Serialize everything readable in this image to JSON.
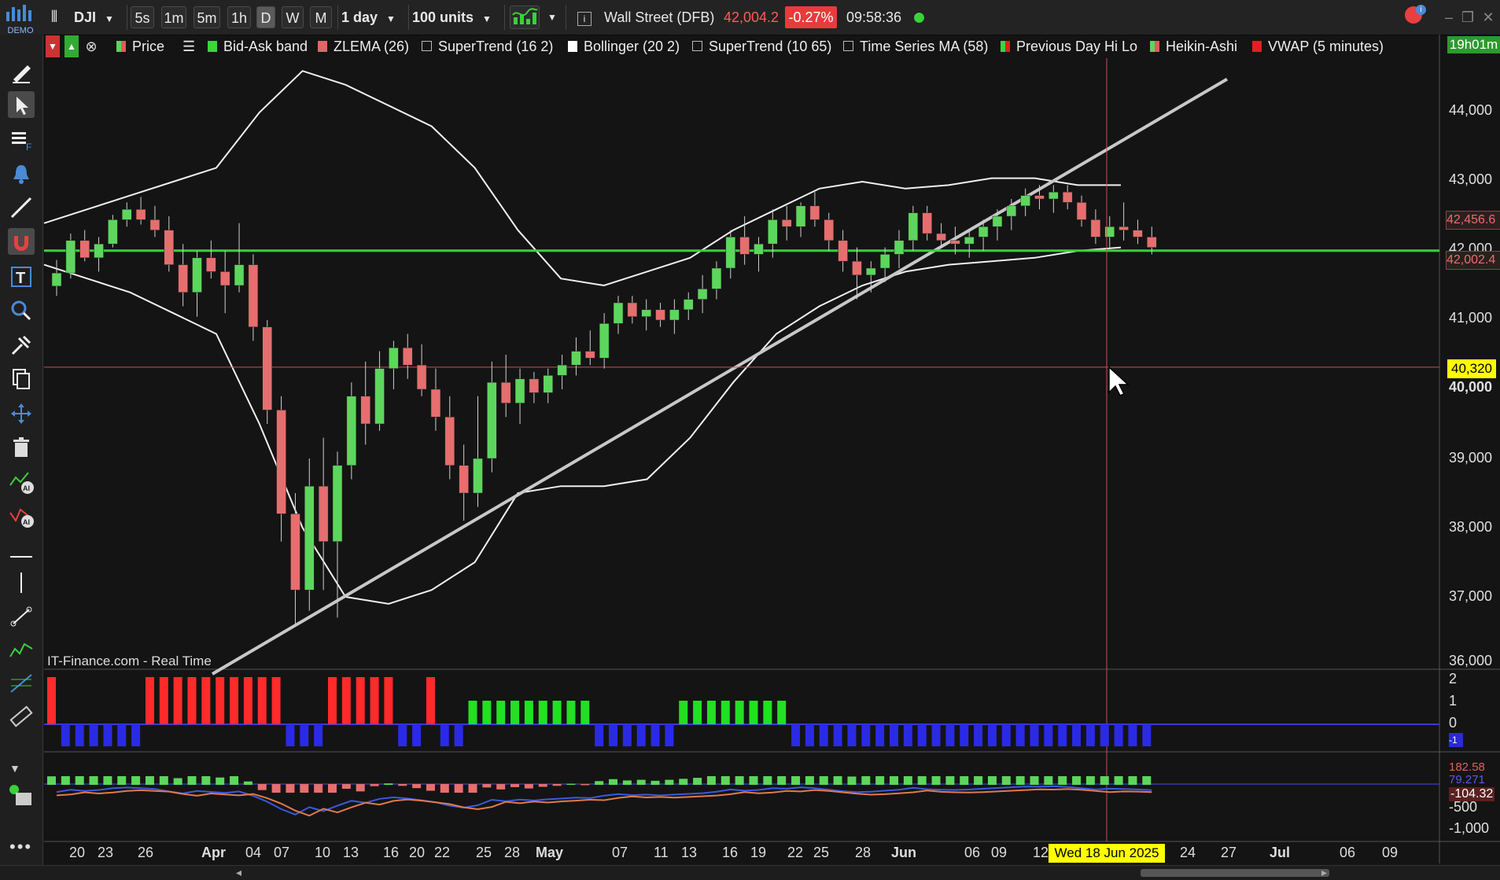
{
  "toolbar": {
    "brand": "DEMO",
    "symbol": "DJI",
    "intervals": [
      "5s",
      "1m",
      "5m",
      "1h",
      "D",
      "W",
      "M"
    ],
    "selected_interval": "D",
    "period": "1 day",
    "units": "100 units",
    "instrument_name": "Wall Street (DFB)",
    "price": "42,004.2",
    "change": "-0.27%",
    "time": "09:58:36",
    "countdown": "19h01m"
  },
  "legend": [
    {
      "label": "Price",
      "swatch": "#5bd65b",
      "swatch2": "#e15b5b"
    },
    {
      "label": "Bid-Ask band",
      "swatch": "#3ad63a"
    },
    {
      "label": "ZLEMA (26)",
      "swatch": "#e06666"
    },
    {
      "label": "SuperTrend (16 2)",
      "checkbox": true
    },
    {
      "label": "Bollinger (20 2)",
      "swatch": "#ffffff"
    },
    {
      "label": "SuperTrend (10 65)",
      "checkbox": true
    },
    {
      "label": "Time Series MA (58)",
      "checkbox": true
    },
    {
      "label": "Previous Day Hi Lo",
      "swatch": "#3ad63a",
      "swatch2": "#e02020"
    },
    {
      "label": "Heikin-Ashi",
      "swatch": "#5bd65b",
      "swatch2": "#e15b5b"
    },
    {
      "label": "VWAP (5 minutes)",
      "swatch": "#e02020"
    }
  ],
  "price_axis": {
    "ticks": [
      "44,000",
      "43,000",
      "42,000",
      "41,000",
      "40,000",
      "39,000",
      "38,000",
      "37,000",
      "36,000"
    ],
    "tags": {
      "zlema": "42,456.6",
      "last": "42,002.4",
      "cursor": "40,320"
    }
  },
  "panel1_axis": [
    "2",
    "1",
    "0",
    "-1"
  ],
  "panel2_axis": [
    "182.58",
    "79.271",
    "-104.32",
    "-500",
    "-1,000"
  ],
  "date_axis": {
    "labels": [
      "20",
      "23",
      "26",
      "Apr",
      "04",
      "07",
      "10",
      "13",
      "16",
      "20",
      "22",
      "25",
      "28",
      "May",
      "07",
      "11",
      "13",
      "16",
      "19",
      "22",
      "25",
      "28",
      "Jun",
      "06",
      "09",
      "12",
      "24",
      "27",
      "Jul",
      "06",
      "09"
    ],
    "cursor_date": "Wed 18 Jun 2025"
  },
  "watermark": "IT-Finance.com - Real Time",
  "colors": {
    "up": "#5dd65d",
    "down": "#e66e6e",
    "accent_green": "#3ad13a",
    "cursor": "#c85050",
    "tag_yellow": "#ffff00"
  },
  "chart_data": {
    "type": "candlestick",
    "candles_ohlc": [
      [
        41490,
        41870,
        41350,
        41680
      ],
      [
        41680,
        42250,
        41600,
        42150
      ],
      [
        42150,
        42300,
        41850,
        41900
      ],
      [
        41900,
        42200,
        41700,
        42100
      ],
      [
        42100,
        42520,
        42050,
        42450
      ],
      [
        42450,
        42700,
        42350,
        42600
      ],
      [
        42600,
        42780,
        42380,
        42450
      ],
      [
        42450,
        42650,
        42200,
        42300
      ],
      [
        42300,
        42500,
        41700,
        41800
      ],
      [
        41800,
        42100,
        41200,
        41400
      ],
      [
        41400,
        42000,
        41050,
        41900
      ],
      [
        41900,
        42150,
        41600,
        41700
      ],
      [
        41700,
        42000,
        41100,
        41500
      ],
      [
        41500,
        42400,
        41400,
        41800
      ],
      [
        41800,
        41950,
        40700,
        40900
      ],
      [
        40900,
        41000,
        39500,
        39700
      ],
      [
        39700,
        39900,
        37800,
        38200
      ],
      [
        38200,
        38500,
        36600,
        37100
      ],
      [
        37100,
        39000,
        36800,
        38600
      ],
      [
        38600,
        39300,
        37100,
        37800
      ],
      [
        37800,
        39100,
        36700,
        38900
      ],
      [
        38900,
        40100,
        38700,
        39900
      ],
      [
        39900,
        40400,
        39200,
        39500
      ],
      [
        39500,
        40550,
        39400,
        40300
      ],
      [
        40300,
        40700,
        40000,
        40600
      ],
      [
        40600,
        40800,
        40150,
        40350
      ],
      [
        40350,
        40650,
        39900,
        40000
      ],
      [
        40000,
        40300,
        39400,
        39600
      ],
      [
        39600,
        39900,
        38700,
        38900
      ],
      [
        38900,
        39200,
        38100,
        38500
      ],
      [
        38500,
        39900,
        38300,
        39000
      ],
      [
        39000,
        40400,
        38800,
        40100
      ],
      [
        40100,
        40500,
        39600,
        39800
      ],
      [
        39800,
        40300,
        39500,
        40150
      ],
      [
        40150,
        40250,
        39800,
        39950
      ],
      [
        39950,
        40300,
        39800,
        40200
      ],
      [
        40200,
        40500,
        40000,
        40350
      ],
      [
        40350,
        40750,
        40200,
        40550
      ],
      [
        40550,
        40850,
        40350,
        40450
      ],
      [
        40450,
        41100,
        40300,
        40950
      ],
      [
        40950,
        41350,
        40800,
        41250
      ],
      [
        41250,
        41350,
        40950,
        41050
      ],
      [
        41050,
        41300,
        40850,
        41150
      ],
      [
        41150,
        41250,
        40900,
        41000
      ],
      [
        41000,
        41300,
        40800,
        41150
      ],
      [
        41150,
        41400,
        41000,
        41300
      ],
      [
        41300,
        41650,
        41100,
        41450
      ],
      [
        41450,
        41850,
        41300,
        41750
      ],
      [
        41750,
        42300,
        41600,
        42200
      ],
      [
        42200,
        42500,
        41800,
        41950
      ],
      [
        41950,
        42200,
        41700,
        42100
      ],
      [
        42100,
        42600,
        41900,
        42450
      ],
      [
        42450,
        42650,
        42150,
        42350
      ],
      [
        42350,
        42700,
        42200,
        42650
      ],
      [
        42650,
        42850,
        42350,
        42450
      ],
      [
        42450,
        42550,
        42000,
        42150
      ],
      [
        42150,
        42300,
        41700,
        41850
      ],
      [
        41850,
        42050,
        41300,
        41650
      ],
      [
        41650,
        41850,
        41400,
        41750
      ],
      [
        41750,
        42050,
        41550,
        41950
      ],
      [
        41950,
        42300,
        41750,
        42150
      ],
      [
        42150,
        42650,
        42000,
        42550
      ],
      [
        42550,
        42650,
        42150,
        42250
      ],
      [
        42250,
        42400,
        42050,
        42150
      ],
      [
        42150,
        42350,
        41950,
        42100
      ],
      [
        42100,
        42300,
        41900,
        42200
      ],
      [
        42200,
        42450,
        42000,
        42350
      ],
      [
        42350,
        42600,
        42150,
        42500
      ],
      [
        42500,
        42750,
        42300,
        42650
      ],
      [
        42650,
        42900,
        42500,
        42800
      ],
      [
        42800,
        42950,
        42600,
        42750
      ],
      [
        42750,
        42950,
        42550,
        42850
      ],
      [
        42850,
        42950,
        42600,
        42700
      ],
      [
        42700,
        42800,
        42350,
        42450
      ],
      [
        42450,
        42600,
        42100,
        42200
      ],
      [
        42200,
        42500,
        42050,
        42350
      ],
      [
        42350,
        42700,
        42150,
        42300
      ],
      [
        42300,
        42450,
        42100,
        42200
      ],
      [
        42200,
        42350,
        41950,
        42050
      ]
    ],
    "bollinger_upper": [
      42400,
      42600,
      42800,
      43000,
      43200,
      44000,
      44600,
      44400,
      44100,
      43800,
      43200,
      42300,
      41600,
      41500,
      41700,
      41900,
      42300,
      42600,
      42900,
      43000,
      42900,
      42950,
      43050,
      43050,
      42950,
      42950
    ],
    "bollinger_lower": [
      41800,
      41600,
      41400,
      41100,
      40800,
      39500,
      38000,
      37000,
      36900,
      37100,
      37500,
      38500,
      38600,
      38600,
      38700,
      39300,
      40100,
      40800,
      41200,
      41500,
      41700,
      41800,
      41850,
      41900,
      42000,
      42050
    ],
    "ylim": [
      35900,
      44500
    ],
    "trendline": {
      "from": [
        "Mar 31",
        36000
      ],
      "to": [
        "Jun 18",
        43800
      ]
    },
    "horizontal_lines": [
      {
        "value": 42002.4,
        "color": "#3ad13a"
      },
      {
        "value": 40320,
        "color": "#c85050"
      }
    ]
  }
}
